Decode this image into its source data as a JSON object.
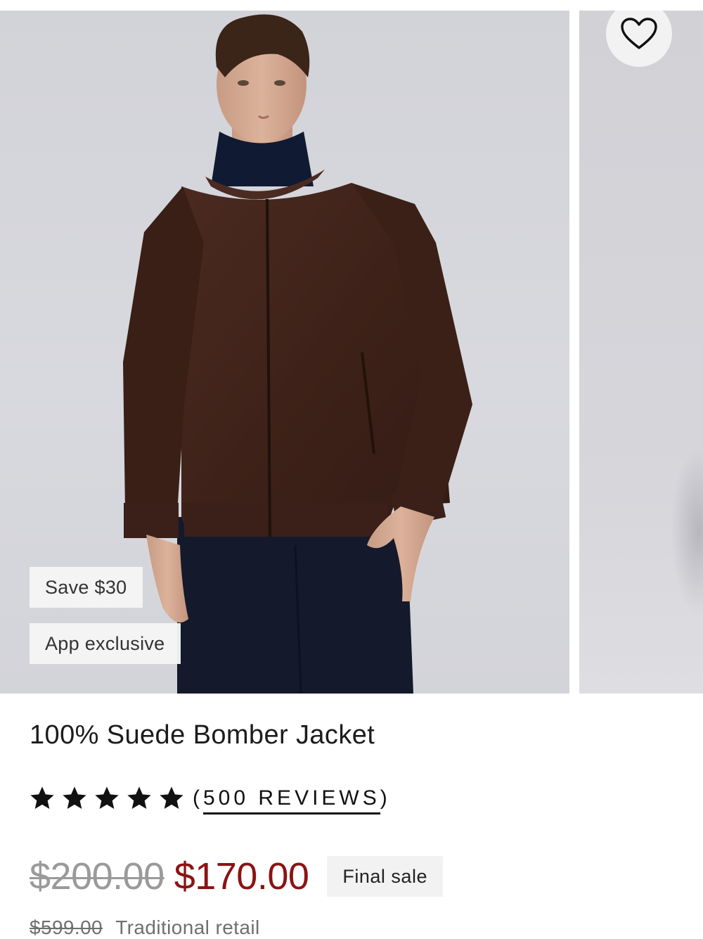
{
  "product": {
    "image_alt": "Model wearing a brown suede bomber jacket over a navy turtleneck",
    "badges": {
      "save": "Save $30",
      "exclusive": "App exclusive"
    },
    "title": "100% Suede Bomber Jacket",
    "rating": {
      "stars": 5,
      "max": 5,
      "reviews_label": "500 REVIEWS"
    },
    "price": {
      "original": "$200.00",
      "sale": "$170.00",
      "final_sale_label": "Final sale",
      "traditional_retail_price": "$599.00",
      "traditional_retail_label": "Traditional retail"
    }
  },
  "icons": {
    "favorite": "heart-outline-icon",
    "star": "star-filled-icon"
  },
  "colors": {
    "sale_price": "#8b1313",
    "strike_price": "#9a9a9a",
    "text": "#1a1a1a"
  }
}
